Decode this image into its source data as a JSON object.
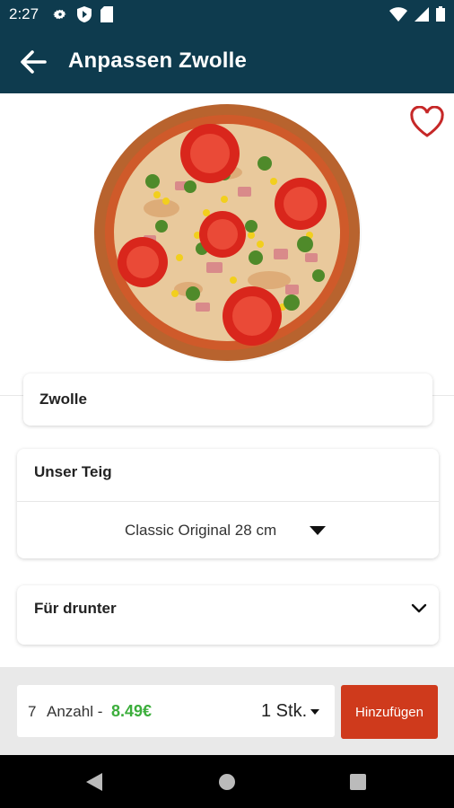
{
  "status_bar": {
    "time": "2:27",
    "left_icons": [
      "gear-icon",
      "shield-icon",
      "sd-card-icon"
    ],
    "right_icons": [
      "wifi-icon",
      "signal-icon",
      "battery-icon"
    ]
  },
  "app_bar": {
    "title": "Anpassen Zwolle",
    "back_icon": "arrow-left-icon"
  },
  "product": {
    "image": "pizza-image",
    "favorite_icon": "heart-outline-icon",
    "name": "Zwolle"
  },
  "dough": {
    "label": "Unser Teig",
    "selected": "Classic Original 28 cm"
  },
  "under": {
    "label": "Für drunter",
    "expand_icon": "chevron-down-icon"
  },
  "order": {
    "count": "7",
    "count_label": "Anzahl -",
    "price": "8.49€",
    "quantity": "1 Stk.",
    "add_label": "Hinzufügen"
  },
  "colors": {
    "app_bar": "#0e3b4e",
    "price": "#3cae3c",
    "add_button": "#cf3a1c",
    "favorite": "#c62828"
  },
  "nav_bar": {
    "icons": [
      "nav-back-icon",
      "nav-home-icon",
      "nav-recents-icon"
    ]
  }
}
